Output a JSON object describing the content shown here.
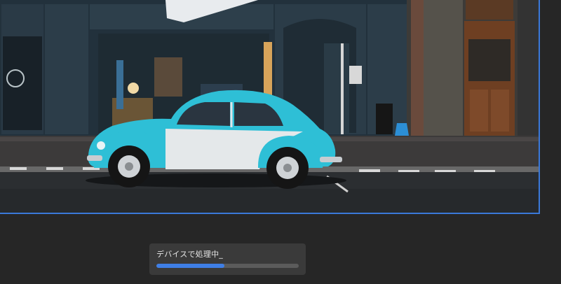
{
  "processing": {
    "label": "デバイスで処理中_",
    "progress_fraction": 0.48
  },
  "colors": {
    "canvas_border": "#3a78d8",
    "progress_fill": "#3f7fe6",
    "progress_track": "#5b5b5b",
    "toast_bg": "#3a3a3a",
    "app_bg": "#262626"
  }
}
